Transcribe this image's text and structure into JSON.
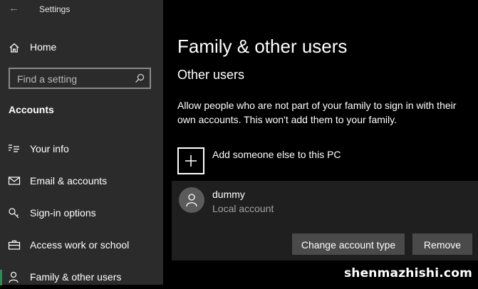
{
  "window": {
    "title": "Settings",
    "back_icon": "back-arrow-icon"
  },
  "sidebar": {
    "home": {
      "label": "Home",
      "icon": "home-icon"
    },
    "search": {
      "placeholder": "Find a setting",
      "icon": "search-icon"
    },
    "section": "Accounts",
    "items": [
      {
        "label": "Your info",
        "icon": "person-card-icon",
        "selected": false
      },
      {
        "label": "Email & accounts",
        "icon": "mail-icon",
        "selected": false
      },
      {
        "label": "Sign-in options",
        "icon": "key-icon",
        "selected": false
      },
      {
        "label": "Access work or school",
        "icon": "briefcase-icon",
        "selected": false
      },
      {
        "label": "Family & other users",
        "icon": "person-icon",
        "selected": true
      }
    ],
    "selected_accent": "#2e8b57"
  },
  "main": {
    "title": "Family & other users",
    "subheading": "Other users",
    "description": "Allow people who are not part of your family to sign in with their own accounts. This won't add them to your family.",
    "add_label": "Add someone else to this PC",
    "user": {
      "name": "dummy",
      "type": "Local account"
    },
    "buttons": {
      "change": "Change account type",
      "remove": "Remove"
    }
  },
  "watermark": "shenmazhishi.com"
}
